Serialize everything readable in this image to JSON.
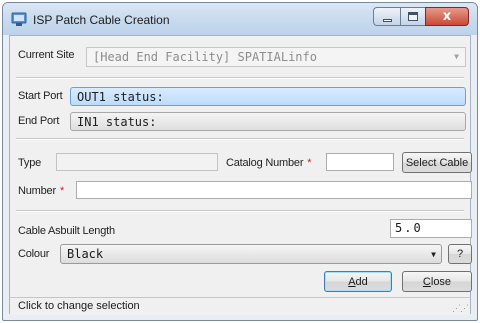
{
  "window": {
    "title": "ISP Patch Cable Creation",
    "icon": "patch-cable-app-icon",
    "controls": {
      "minimize_icon": "minimize-icon",
      "maximize_icon": "maximize-icon",
      "close_icon": "close-icon",
      "close_glyph": "x"
    }
  },
  "form": {
    "current_site": {
      "label": "Current Site",
      "value": "[Head End Facility] SPATIALinfo",
      "arrow": "▼",
      "enabled": false
    },
    "start_port": {
      "label": "Start Port",
      "value": "OUT1 status:"
    },
    "end_port": {
      "label": "End Port",
      "value": "IN1 status:"
    },
    "type": {
      "label": "Type",
      "value": ""
    },
    "catalog_number": {
      "label": "Catalog Number",
      "required_mark": "*",
      "value": ""
    },
    "select_cable_button": "Select Cable",
    "number": {
      "label": "Number",
      "required_mark": "*",
      "value": ""
    },
    "cable_asbuilt_length": {
      "label": "Cable Asbuilt Length",
      "value": "5.0"
    },
    "colour": {
      "label": "Colour",
      "value": "Black",
      "arrow": "▼"
    },
    "help_button": "?",
    "add_button": {
      "label_accel": "A",
      "label_rest": "dd"
    },
    "close_button": {
      "label_accel": "C",
      "label_rest": "lose"
    }
  },
  "status_bar": {
    "text": "Click to change selection",
    "grip": "⋰⋰"
  },
  "colors": {
    "title_gradient_top": "#dbe7f4",
    "close_button_red": "#c84a35",
    "selected_field_blue": "#bcdcfa",
    "required_red": "#d21f1f",
    "client_background": "#f0f0f0"
  }
}
